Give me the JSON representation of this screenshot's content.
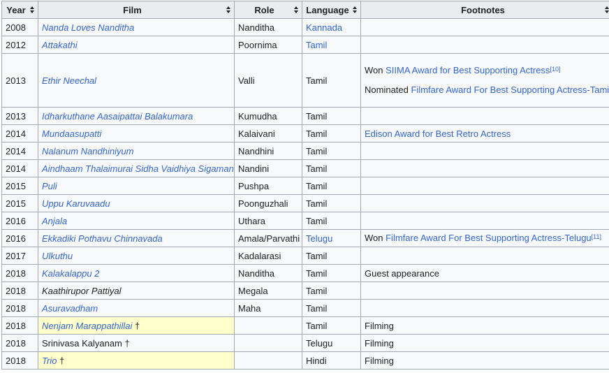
{
  "headers": [
    "Year",
    "Film",
    "Role",
    "Language",
    "Footnotes"
  ],
  "rows": [
    {
      "year": "2008",
      "film": "Nanda Loves Nanditha",
      "film_link": true,
      "role": "Nanditha",
      "language": "Kannada",
      "lang_link": true,
      "footnote": ""
    },
    {
      "year": "2012",
      "film": "Attakathi",
      "film_link": true,
      "role": "Poornima",
      "language": "Tamil",
      "lang_link": true,
      "footnote": ""
    },
    {
      "year": "2013",
      "film": "Ethir Neechal",
      "film_link": true,
      "role": "Valli",
      "language": "Tamil",
      "lang_link": false,
      "footnote_won_prefix": "Won ",
      "footnote_won_link": "SIIMA Award for Best Supporting Actress",
      "footnote_won_ref": "[10]",
      "footnote_nom_prefix": "Nominated ",
      "footnote_nom_link": "Filmfare Award For Best Supporting Actress-Tamil"
    },
    {
      "year": "2013",
      "film": "Idharkuthane Aasaipattai Balakumara",
      "film_link": true,
      "role": "Kumudha",
      "language": "Tamil",
      "lang_link": false,
      "footnote": ""
    },
    {
      "year": "2014",
      "film": "Mundaasupatti",
      "film_link": true,
      "role": "Kalaivani",
      "language": "Tamil",
      "lang_link": false,
      "footnote_link": "Edison Award for Best Retro Actress"
    },
    {
      "year": "2014",
      "film": "Nalanum Nandhiniyum",
      "film_link": true,
      "role": "Nandhini",
      "language": "Tamil",
      "lang_link": false,
      "footnote": ""
    },
    {
      "year": "2014",
      "film": "Aindhaam Thalaimurai Sidha Vaidhiya Sigamani",
      "film_link": true,
      "role": "Nandini",
      "language": "Tamil",
      "lang_link": false,
      "footnote": ""
    },
    {
      "year": "2015",
      "film": "Puli",
      "film_link": true,
      "role": "Pushpa",
      "language": "Tamil",
      "lang_link": false,
      "footnote": ""
    },
    {
      "year": "2015",
      "film": "Uppu Karuvaadu",
      "film_link": true,
      "role": "Poonguzhali",
      "language": "Tamil",
      "lang_link": false,
      "footnote": ""
    },
    {
      "year": "2016",
      "film": "Anjala",
      "film_link": true,
      "role": "Uthara",
      "language": "Tamil",
      "lang_link": false,
      "footnote": ""
    },
    {
      "year": "2016",
      "film": "Ekkadiki Pothavu Chinnavada",
      "film_link": true,
      "role": "Amala/Parvathi",
      "language": "Telugu",
      "lang_link": true,
      "footnote_won_prefix": "Won ",
      "footnote_won_link": "Filmfare Award For Best Supporting Actress-Telugu",
      "footnote_won_ref": "[11]"
    },
    {
      "year": "2017",
      "film": "Ulkuthu",
      "film_link": true,
      "role": "Kadalarasi",
      "language": "Tamil",
      "lang_link": false,
      "footnote": ""
    },
    {
      "year": "2018",
      "film": "Kalakalappu 2",
      "film_link": true,
      "role": "Nanditha",
      "language": "Tamil",
      "lang_link": false,
      "footnote": "Guest appearance"
    },
    {
      "year": "2018",
      "film": "Kaathirupor Pattiyal",
      "film_link": false,
      "film_italic": true,
      "role": "Megala",
      "language": "Tamil",
      "lang_link": false,
      "footnote": ""
    },
    {
      "year": "2018",
      "film": "Asuravadham",
      "film_link": true,
      "role": "Maha",
      "language": "Tamil",
      "lang_link": false,
      "footnote": ""
    },
    {
      "year": "2018",
      "film": "Nenjam Marappathillai",
      "film_link": true,
      "upcoming": true,
      "dagger": "†",
      "role": "",
      "language": "Tamil",
      "lang_link": false,
      "footnote": "Filming"
    },
    {
      "year": "2018",
      "film": "Srinivasa Kalyanam",
      "film_link": false,
      "dagger": "†",
      "role": "",
      "language": "Telugu",
      "lang_link": false,
      "footnote": "Filming"
    },
    {
      "year": "2018",
      "film": "Trio",
      "film_link": true,
      "upcoming": true,
      "dagger": "†",
      "role": "",
      "language": "Hindi",
      "lang_link": false,
      "footnote": "Filming"
    }
  ]
}
